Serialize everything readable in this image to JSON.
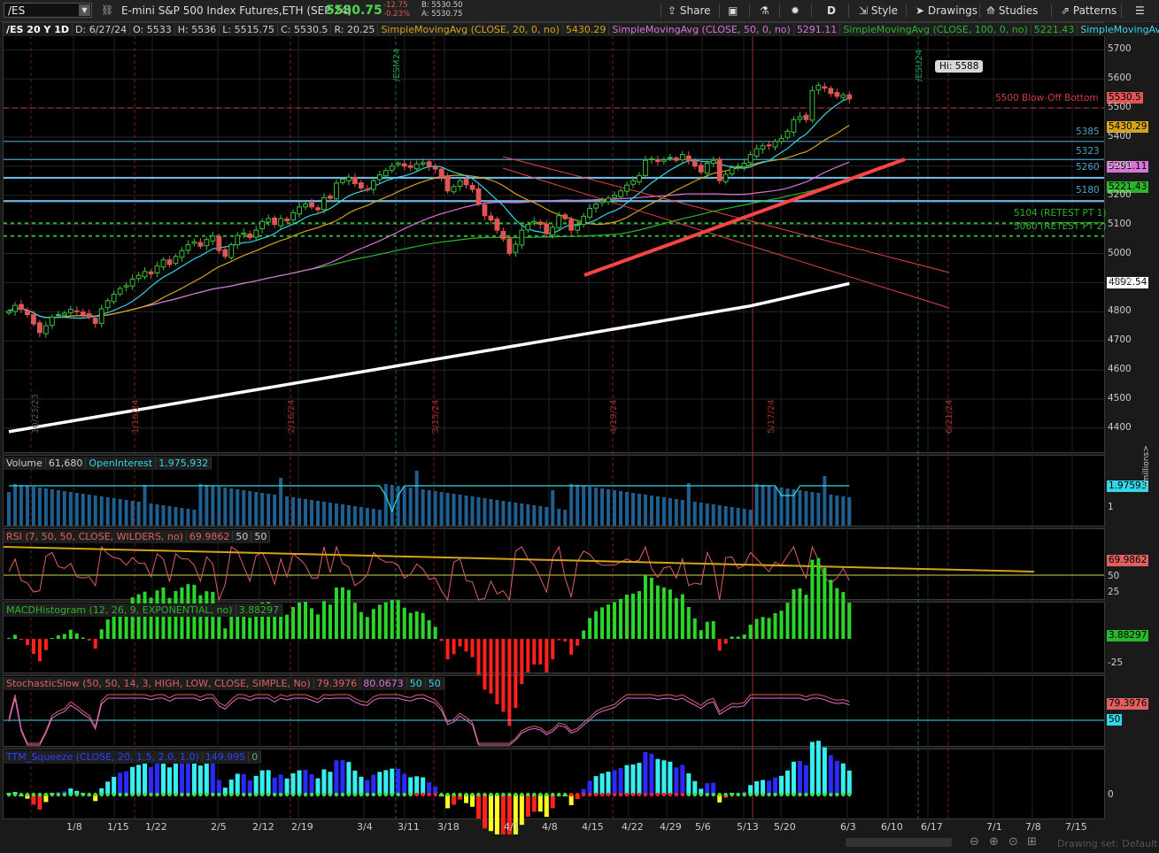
{
  "toolbar": {
    "symbol": "/ES",
    "description": "E-mini S&P 500 Index Futures,ETH (SEP 24)",
    "last": "5530.75",
    "change": "-12.75",
    "change_pct": "-0.23%",
    "bid": "B: 5530.50",
    "ask": "A: 5530.75",
    "share": "Share",
    "period": "D",
    "style": "Style",
    "drawings": "Drawings",
    "studies": "Studies",
    "patterns": "Patterns"
  },
  "price_legend": {
    "ticker": "/ES 20 Y 1D",
    "date": "D: 6/27/24",
    "open": "O: 5533",
    "high": "H: 5536",
    "low": "L: 5515.75",
    "close": "C: 5530.5",
    "range": "R: 20.25",
    "sma20": "SimpleMovingAvg (CLOSE, 20, 0, no)",
    "sma20_val": "5430.29",
    "sma50": "SimpleMovingAvg (CLOSE, 50, 0, no)",
    "sma50_val": "5291.11",
    "sma100": "SimpleMovingAvg (CLOSE, 100, 0, no)",
    "sma100_val": "5221.43",
    "sma200": "SimpleMovingAvg ..."
  },
  "annotations": {
    "hi": "Hi: 5588",
    "blowoff": "5500 Blow-Off Bottom",
    "retest1": "5104 (RETEST PT 1)",
    "retest2": "5060 (RETEST PT 2)",
    "lvl5385": "5385",
    "lvl5323": "5323",
    "lvl5260": "5260",
    "lvl5180": "5180",
    "esm24": "/ESM24",
    "esu24": "/ESU24",
    "v_dates": [
      "10/23/23",
      "1/16/24",
      "2/16/24",
      "3/15/24",
      "4/19/24",
      "5/17/24",
      "6/21/24"
    ]
  },
  "price_tags": {
    "last": "5530.5",
    "sma20": "5430.29",
    "sma50": "5291.11",
    "sma100": "5221.43",
    "sma200": "4892.54"
  },
  "volume_legend": {
    "label": "Volume",
    "value": "61,680",
    "oi_label": "OpenInterest",
    "oi_value": "1,975,932",
    "oi_tag": "1.97593",
    "tick1": "1",
    "unit": "<millions>"
  },
  "rsi_legend": {
    "label": "RSI (7, 50, 50, CLOSE, WILDERS, no)",
    "value": "69.9862",
    "ob": "50",
    "os": "50",
    "tag": "69.9862",
    "t50": "50",
    "t25": "25"
  },
  "macd_legend": {
    "label": "MACDHistogram (12, 26, 9, EXPONENTIAL, no)",
    "value": "3.88297",
    "tag": "3.88297",
    "tneg": "-25"
  },
  "stoch_legend": {
    "label": "StochasticSlow (50, 50, 14, 3, HIGH, LOW, CLOSE, SIMPLE, No)",
    "k": "79.3976",
    "d": "80.0673",
    "ob": "50",
    "os": "50",
    "tag_k": "79.3976",
    "tag_50": "50"
  },
  "squeeze_legend": {
    "label": "TTM_Squeeze (CLOSE, 20, 1.5, 2.0, 1.0)",
    "value": "149.995",
    "sig": "0",
    "t0": "0"
  },
  "footer": {
    "drawing_set": "Drawing set: Default"
  },
  "colors": {
    "up": "#3fbf3f",
    "down": "#e05555",
    "sma20": "#35d6e6",
    "sma50": "#d4a31c",
    "sma100": "#2bb52b",
    "sma200": "#ffffff",
    "rsi": "#e06060",
    "level": "#4aa3c7",
    "trend": "#ff4444"
  },
  "chart_data": {
    "type": "candlestick",
    "ylim": [
      4300,
      5730
    ],
    "y_ticks": [
      4400,
      4500,
      4600,
      4700,
      4800,
      4900,
      5000,
      5100,
      5200,
      5300,
      5400,
      5500,
      5600,
      5700
    ],
    "x_ticks": [
      "1/8",
      "1/15",
      "1/22",
      "2/5",
      "2/12",
      "2/19",
      "3/4",
      "3/11",
      "3/18",
      "4/1",
      "4/8",
      "4/15",
      "4/22",
      "4/29",
      "5/6",
      "5/13",
      "5/20",
      "6/3",
      "6/10",
      "6/17",
      "7/1",
      "7/8",
      "7/15"
    ],
    "close": [
      4802,
      4822,
      4808,
      4790,
      4758,
      4728,
      4752,
      4782,
      4790,
      4795,
      4808,
      4800,
      4790,
      4782,
      4760,
      4810,
      4838,
      4860,
      4880,
      4890,
      4912,
      4925,
      4938,
      4930,
      4958,
      4978,
      4962,
      4990,
      5010,
      5030,
      5040,
      5025,
      5048,
      5060,
      5010,
      4990,
      5030,
      5062,
      5070,
      5055,
      5080,
      5110,
      5120,
      5100,
      5120,
      5112,
      5140,
      5160,
      5170,
      5160,
      5150,
      5192,
      5190,
      5242,
      5255,
      5262,
      5240,
      5225,
      5220,
      5250,
      5270,
      5285,
      5300,
      5310,
      5300,
      5296,
      5308,
      5312,
      5300,
      5290,
      5260,
      5215,
      5230,
      5250,
      5236,
      5220,
      5172,
      5130,
      5115,
      5080,
      5050,
      5000,
      5032,
      5080,
      5100,
      5110,
      5100,
      5068,
      5090,
      5130,
      5120,
      5080,
      5096,
      5128,
      5155,
      5170,
      5180,
      5190,
      5200,
      5215,
      5235,
      5250,
      5268,
      5320,
      5325,
      5316,
      5322,
      5330,
      5320,
      5340,
      5318,
      5300,
      5280,
      5310,
      5320,
      5250,
      5272,
      5295,
      5300,
      5310,
      5340,
      5360,
      5370,
      5370,
      5385,
      5395,
      5420,
      5460,
      5470,
      5460,
      5560,
      5578,
      5568,
      5550,
      5540,
      5545,
      5531
    ]
  }
}
